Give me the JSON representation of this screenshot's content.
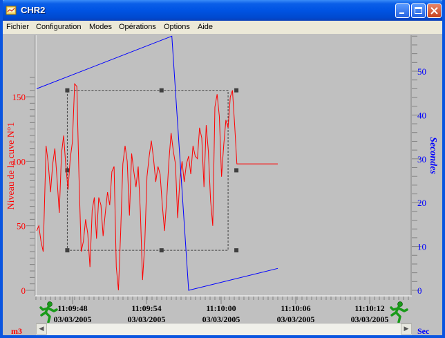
{
  "window": {
    "title": "CHR2"
  },
  "menu": [
    "Fichier",
    "Configuration",
    "Modes",
    "Opérations",
    "Options",
    "Aide"
  ],
  "colors": {
    "left_axis": "#ff0000",
    "right_axis": "#0000ff",
    "plot_bg": "#c0c0c0"
  },
  "icons": {
    "app": "app-icon",
    "runner_left": "runner-icon",
    "runner_right": "runner-icon"
  },
  "chart_data": {
    "type": "line",
    "ylabel_left": "Niveau de la cuve N°1",
    "ylabel_right": "Secondes",
    "unit_left": "m3",
    "unit_right": "Sec",
    "yticks_left": [
      "0",
      "50",
      "100",
      "150"
    ],
    "yticks_right": [
      "0",
      "10",
      "20",
      "30",
      "40",
      "50"
    ],
    "xticks": [
      {
        "time": "11:09:48",
        "date": "03/03/2005"
      },
      {
        "time": "11:09:54",
        "date": "03/03/2005"
      },
      {
        "time": "11:10:00",
        "date": "03/03/2005"
      },
      {
        "time": "11:10:06",
        "date": "03/03/2005"
      },
      {
        "time": "11:10:12",
        "date": "03/03/2005"
      }
    ],
    "ylim_left": [
      0,
      165
    ],
    "ylim_right": [
      0,
      55
    ],
    "series": [
      {
        "name": "Niveau de la cuve N°1",
        "axis": "left",
        "color": "#ff0000",
        "points": [
          [
            0,
            46
          ],
          [
            0.3,
            50
          ],
          [
            0.6,
            38
          ],
          [
            0.9,
            30
          ],
          [
            1.3,
            112
          ],
          [
            1.6,
            98
          ],
          [
            1.9,
            76
          ],
          [
            2.2,
            98
          ],
          [
            2.5,
            110
          ],
          [
            2.8,
            86
          ],
          [
            3.1,
            60
          ],
          [
            3.4,
            106
          ],
          [
            3.7,
            120
          ],
          [
            4.0,
            96
          ],
          [
            4.3,
            78
          ],
          [
            4.6,
            102
          ],
          [
            4.9,
            115
          ],
          [
            5.2,
            160
          ],
          [
            5.5,
            158
          ],
          [
            5.8,
            88
          ],
          [
            6.1,
            30
          ],
          [
            6.4,
            38
          ],
          [
            6.7,
            55
          ],
          [
            7.0,
            44
          ],
          [
            7.3,
            18
          ],
          [
            7.6,
            62
          ],
          [
            7.9,
            72
          ],
          [
            8.2,
            40
          ],
          [
            8.5,
            72
          ],
          [
            8.8,
            66
          ],
          [
            9.1,
            42
          ],
          [
            9.4,
            60
          ],
          [
            9.7,
            76
          ],
          [
            10.0,
            66
          ],
          [
            10.3,
            92
          ],
          [
            10.6,
            96
          ],
          [
            10.9,
            18
          ],
          [
            11.2,
            0
          ],
          [
            11.5,
            45
          ],
          [
            11.8,
            98
          ],
          [
            12.1,
            112
          ],
          [
            12.4,
            100
          ],
          [
            12.7,
            58
          ],
          [
            13.0,
            106
          ],
          [
            13.3,
            92
          ],
          [
            13.6,
            80
          ],
          [
            13.9,
            96
          ],
          [
            14.2,
            60
          ],
          [
            14.5,
            8
          ],
          [
            14.8,
            36
          ],
          [
            15.1,
            88
          ],
          [
            15.4,
            104
          ],
          [
            15.7,
            116
          ],
          [
            16.0,
            102
          ],
          [
            16.3,
            84
          ],
          [
            16.6,
            96
          ],
          [
            16.9,
            90
          ],
          [
            17.2,
            66
          ],
          [
            17.5,
            46
          ],
          [
            17.8,
            70
          ],
          [
            18.1,
            100
          ],
          [
            18.4,
            122
          ],
          [
            18.7,
            108
          ],
          [
            19.0,
            98
          ],
          [
            19.3,
            56
          ],
          [
            19.6,
            86
          ],
          [
            19.9,
            100
          ],
          [
            20.2,
            84
          ],
          [
            20.5,
            98
          ],
          [
            20.8,
            104
          ],
          [
            21.1,
            90
          ],
          [
            21.4,
            112
          ],
          [
            21.7,
            104
          ],
          [
            22.0,
            102
          ],
          [
            22.3,
            126
          ],
          [
            22.6,
            118
          ],
          [
            22.9,
            80
          ],
          [
            23.2,
            128
          ],
          [
            23.5,
            108
          ],
          [
            23.8,
            70
          ],
          [
            24.1,
            50
          ],
          [
            24.4,
            142
          ],
          [
            24.7,
            152
          ],
          [
            25.0,
            135
          ],
          [
            25.3,
            88
          ],
          [
            25.6,
            112
          ],
          [
            25.9,
            132
          ],
          [
            26.2,
            126
          ],
          [
            26.5,
            150
          ],
          [
            26.8,
            155
          ],
          [
            27.1,
            128
          ],
          [
            27.4,
            98
          ],
          [
            28.0,
            98
          ],
          [
            29.0,
            98
          ],
          [
            30.0,
            98
          ],
          [
            31.0,
            98
          ],
          [
            32.0,
            98
          ],
          [
            33.0,
            98
          ]
        ]
      },
      {
        "name": "Secondes",
        "axis": "right",
        "color": "#0000ff",
        "points": [
          [
            0,
            46
          ],
          [
            18.5,
            58
          ],
          [
            20.8,
            0
          ],
          [
            33.0,
            5
          ]
        ]
      }
    ],
    "selection_box": {
      "x0": 4.2,
      "x1": 26.2,
      "y_top": 155,
      "y_bottom": 31
    }
  }
}
